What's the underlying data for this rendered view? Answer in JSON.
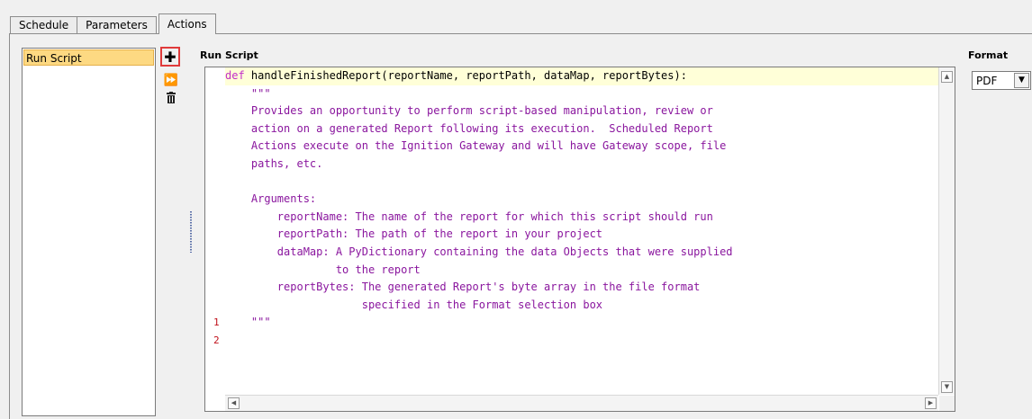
{
  "tabs": [
    {
      "label": "Schedule"
    },
    {
      "label": "Parameters"
    },
    {
      "label": "Actions",
      "active": true
    }
  ],
  "action_list": {
    "items": [
      {
        "label": "Run Script",
        "selected": true
      }
    ]
  },
  "toolbar": {
    "add_icon": "plus-icon",
    "fast_forward_icon": "fast-forward-icon",
    "delete_icon": "trash-icon"
  },
  "editor": {
    "title": "Run Script",
    "code_lines": [
      {
        "text": "def handleFinishedReport(reportName, reportPath, dataMap, reportBytes):"
      },
      {
        "text": "    \"\"\""
      },
      {
        "text": "    Provides an opportunity to perform script-based manipulation, review or"
      },
      {
        "text": "    action on a generated Report following its execution.  Scheduled Report"
      },
      {
        "text": "    Actions execute on the Ignition Gateway and will have Gateway scope, file"
      },
      {
        "text": "    paths, etc."
      },
      {
        "text": ""
      },
      {
        "text": "    Arguments:"
      },
      {
        "text": "        reportName: The name of the report for which this script should run"
      },
      {
        "text": "        reportPath: The path of the report in your project"
      },
      {
        "text": "        dataMap: A PyDictionary containing the data Objects that were supplied"
      },
      {
        "text": "                 to the report"
      },
      {
        "text": "        reportBytes: The generated Report's byte array in the file format"
      },
      {
        "text": "                     specified in the Format selection box"
      },
      {
        "text": "    \"\"\""
      },
      {
        "text": ""
      }
    ],
    "line_numbers": [
      "1",
      "2"
    ]
  },
  "format": {
    "label": "Format",
    "value": "PDF"
  },
  "colors": {
    "accent_highlight": "#fdd982",
    "code_text": "#8a169e",
    "line_number": "#c0101a",
    "add_button_border": "#e03a3a"
  }
}
